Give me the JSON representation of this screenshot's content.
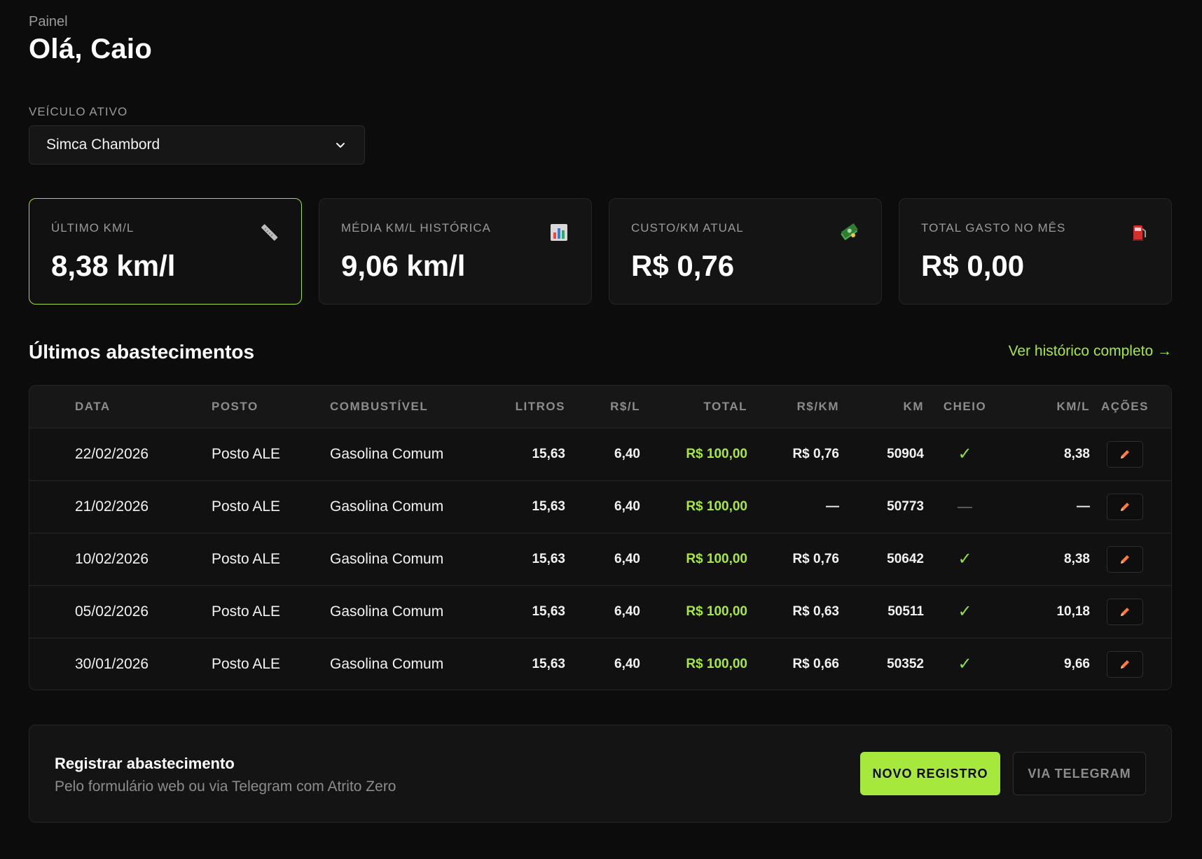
{
  "header": {
    "breadcrumb": "Painel",
    "greeting": "Olá, Caio"
  },
  "vehicle": {
    "label": "VEÍCULO ATIVO",
    "selected": "Simca Chambord"
  },
  "stats": [
    {
      "label": "ÚLTIMO KM/L",
      "value": "8,38 km/l",
      "icon": "ruler-icon"
    },
    {
      "label": "MÉDIA KM/L HISTÓRICA",
      "value": "9,06 km/l",
      "icon": "bar-chart-icon"
    },
    {
      "label": "CUSTO/KM ATUAL",
      "value": "R$ 0,76",
      "icon": "money-icon"
    },
    {
      "label": "TOTAL GASTO NO MÊS",
      "value": "R$ 0,00",
      "icon": "fuel-pump-icon"
    }
  ],
  "recent": {
    "title": "Últimos abastecimentos",
    "link": "Ver histórico completo →",
    "columns": [
      "DATA",
      "POSTO",
      "COMBUSTÍVEL",
      "LITROS",
      "R$/L",
      "TOTAL",
      "R$/KM",
      "KM",
      "CHEIO",
      "KM/L",
      "AÇÕES"
    ],
    "rows": [
      {
        "data": "22/02/2026",
        "posto": "Posto ALE",
        "combustivel": "Gasolina Comum",
        "litros": "15,63",
        "rs_l": "6,40",
        "total": "R$ 100,00",
        "rs_km": "R$ 0,76",
        "km": "50904",
        "cheio": "✓",
        "km_l": "8,38"
      },
      {
        "data": "21/02/2026",
        "posto": "Posto ALE",
        "combustivel": "Gasolina Comum",
        "litros": "15,63",
        "rs_l": "6,40",
        "total": "R$ 100,00",
        "rs_km": "—",
        "km": "50773",
        "cheio": "—",
        "km_l": "—"
      },
      {
        "data": "10/02/2026",
        "posto": "Posto ALE",
        "combustivel": "Gasolina Comum",
        "litros": "15,63",
        "rs_l": "6,40",
        "total": "R$ 100,00",
        "rs_km": "R$ 0,76",
        "km": "50642",
        "cheio": "✓",
        "km_l": "8,38"
      },
      {
        "data": "05/02/2026",
        "posto": "Posto ALE",
        "combustivel": "Gasolina Comum",
        "litros": "15,63",
        "rs_l": "6,40",
        "total": "R$ 100,00",
        "rs_km": "R$ 0,63",
        "km": "50511",
        "cheio": "✓",
        "km_l": "10,18"
      },
      {
        "data": "30/01/2026",
        "posto": "Posto ALE",
        "combustivel": "Gasolina Comum",
        "litros": "15,63",
        "rs_l": "6,40",
        "total": "R$ 100,00",
        "rs_km": "R$ 0,66",
        "km": "50352",
        "cheio": "✓",
        "km_l": "9,66"
      }
    ]
  },
  "register": {
    "title": "Registrar abastecimento",
    "subtitle": "Pelo formulário web ou via Telegram com Atrito Zero",
    "primary_button": "NOVO REGISTRO",
    "secondary_button": "VIA TELEGRAM"
  },
  "colors": {
    "accent": "#a6e93c",
    "background": "#0c0c0c",
    "card": "#141414"
  }
}
